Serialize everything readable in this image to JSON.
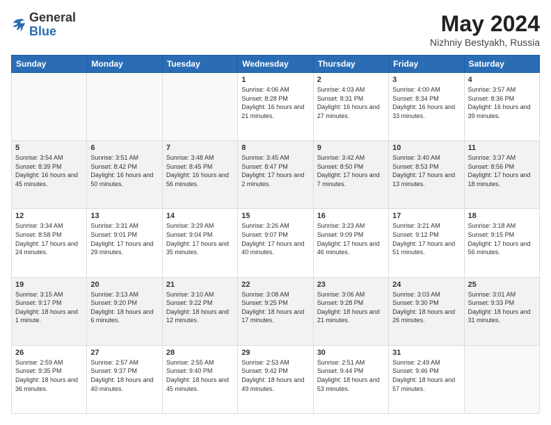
{
  "header": {
    "logo_general": "General",
    "logo_blue": "Blue",
    "month_year": "May 2024",
    "location": "Nizhniy Bestyakh, Russia"
  },
  "days_of_week": [
    "Sunday",
    "Monday",
    "Tuesday",
    "Wednesday",
    "Thursday",
    "Friday",
    "Saturday"
  ],
  "weeks": [
    [
      {
        "day": "",
        "info": ""
      },
      {
        "day": "",
        "info": ""
      },
      {
        "day": "",
        "info": ""
      },
      {
        "day": "1",
        "info": "Sunrise: 4:06 AM\nSunset: 8:28 PM\nDaylight: 16 hours and 21 minutes."
      },
      {
        "day": "2",
        "info": "Sunrise: 4:03 AM\nSunset: 8:31 PM\nDaylight: 16 hours and 27 minutes."
      },
      {
        "day": "3",
        "info": "Sunrise: 4:00 AM\nSunset: 8:34 PM\nDaylight: 16 hours and 33 minutes."
      },
      {
        "day": "4",
        "info": "Sunrise: 3:57 AM\nSunset: 8:36 PM\nDaylight: 16 hours and 39 minutes."
      }
    ],
    [
      {
        "day": "5",
        "info": "Sunrise: 3:54 AM\nSunset: 8:39 PM\nDaylight: 16 hours and 45 minutes."
      },
      {
        "day": "6",
        "info": "Sunrise: 3:51 AM\nSunset: 8:42 PM\nDaylight: 16 hours and 50 minutes."
      },
      {
        "day": "7",
        "info": "Sunrise: 3:48 AM\nSunset: 8:45 PM\nDaylight: 16 hours and 56 minutes."
      },
      {
        "day": "8",
        "info": "Sunrise: 3:45 AM\nSunset: 8:47 PM\nDaylight: 17 hours and 2 minutes."
      },
      {
        "day": "9",
        "info": "Sunrise: 3:42 AM\nSunset: 8:50 PM\nDaylight: 17 hours and 7 minutes."
      },
      {
        "day": "10",
        "info": "Sunrise: 3:40 AM\nSunset: 8:53 PM\nDaylight: 17 hours and 13 minutes."
      },
      {
        "day": "11",
        "info": "Sunrise: 3:37 AM\nSunset: 8:56 PM\nDaylight: 17 hours and 18 minutes."
      }
    ],
    [
      {
        "day": "12",
        "info": "Sunrise: 3:34 AM\nSunset: 8:58 PM\nDaylight: 17 hours and 24 minutes."
      },
      {
        "day": "13",
        "info": "Sunrise: 3:31 AM\nSunset: 9:01 PM\nDaylight: 17 hours and 29 minutes."
      },
      {
        "day": "14",
        "info": "Sunrise: 3:29 AM\nSunset: 9:04 PM\nDaylight: 17 hours and 35 minutes."
      },
      {
        "day": "15",
        "info": "Sunrise: 3:26 AM\nSunset: 9:07 PM\nDaylight: 17 hours and 40 minutes."
      },
      {
        "day": "16",
        "info": "Sunrise: 3:23 AM\nSunset: 9:09 PM\nDaylight: 17 hours and 46 minutes."
      },
      {
        "day": "17",
        "info": "Sunrise: 3:21 AM\nSunset: 9:12 PM\nDaylight: 17 hours and 51 minutes."
      },
      {
        "day": "18",
        "info": "Sunrise: 3:18 AM\nSunset: 9:15 PM\nDaylight: 17 hours and 56 minutes."
      }
    ],
    [
      {
        "day": "19",
        "info": "Sunrise: 3:15 AM\nSunset: 9:17 PM\nDaylight: 18 hours and 1 minute."
      },
      {
        "day": "20",
        "info": "Sunrise: 3:13 AM\nSunset: 9:20 PM\nDaylight: 18 hours and 6 minutes."
      },
      {
        "day": "21",
        "info": "Sunrise: 3:10 AM\nSunset: 9:22 PM\nDaylight: 18 hours and 12 minutes."
      },
      {
        "day": "22",
        "info": "Sunrise: 3:08 AM\nSunset: 9:25 PM\nDaylight: 18 hours and 17 minutes."
      },
      {
        "day": "23",
        "info": "Sunrise: 3:06 AM\nSunset: 9:28 PM\nDaylight: 18 hours and 21 minutes."
      },
      {
        "day": "24",
        "info": "Sunrise: 3:03 AM\nSunset: 9:30 PM\nDaylight: 18 hours and 26 minutes."
      },
      {
        "day": "25",
        "info": "Sunrise: 3:01 AM\nSunset: 9:33 PM\nDaylight: 18 hours and 31 minutes."
      }
    ],
    [
      {
        "day": "26",
        "info": "Sunrise: 2:59 AM\nSunset: 9:35 PM\nDaylight: 18 hours and 36 minutes."
      },
      {
        "day": "27",
        "info": "Sunrise: 2:57 AM\nSunset: 9:37 PM\nDaylight: 18 hours and 40 minutes."
      },
      {
        "day": "28",
        "info": "Sunrise: 2:55 AM\nSunset: 9:40 PM\nDaylight: 18 hours and 45 minutes."
      },
      {
        "day": "29",
        "info": "Sunrise: 2:53 AM\nSunset: 9:42 PM\nDaylight: 18 hours and 49 minutes."
      },
      {
        "day": "30",
        "info": "Sunrise: 2:51 AM\nSunset: 9:44 PM\nDaylight: 18 hours and 53 minutes."
      },
      {
        "day": "31",
        "info": "Sunrise: 2:49 AM\nSunset: 9:46 PM\nDaylight: 18 hours and 57 minutes."
      },
      {
        "day": "",
        "info": ""
      }
    ]
  ]
}
